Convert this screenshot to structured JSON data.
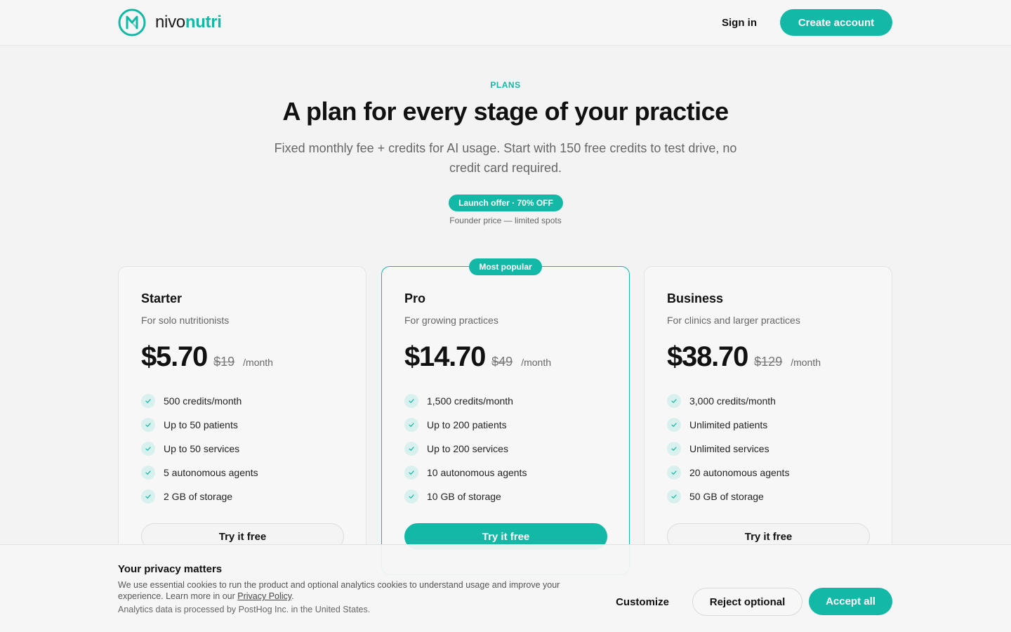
{
  "header": {
    "logo_part1": "nivo",
    "logo_part2": "nutri",
    "signin_label": "Sign in",
    "create_label": "Create account"
  },
  "hero": {
    "eyebrow": "PLANS",
    "title": "A plan for every stage of your practice",
    "subtitle": "Fixed monthly fee + credits for AI usage. Start with 150 free credits to test drive, no credit card required.",
    "offer_badge": "Launch offer · 70% OFF",
    "founder_note": "Founder price — limited spots"
  },
  "plans": [
    {
      "name": "Starter",
      "desc": "For solo nutritionists",
      "price": "$5.70",
      "old_price": "$19",
      "period": "/month",
      "features": [
        "500 credits/month",
        "Up to 50 patients",
        "Up to 50 services",
        "5 autonomous agents",
        "2 GB of storage"
      ],
      "cta": "Try it free"
    },
    {
      "name": "Pro",
      "badge": "Most popular",
      "desc": "For growing practices",
      "price": "$14.70",
      "old_price": "$49",
      "period": "/month",
      "features": [
        "1,500 credits/month",
        "Up to 200 patients",
        "Up to 200 services",
        "10 autonomous agents",
        "10 GB of storage"
      ],
      "cta": "Try it free"
    },
    {
      "name": "Business",
      "desc": "For clinics and larger practices",
      "price": "$38.70",
      "old_price": "$129",
      "period": "/month",
      "features": [
        "3,000 credits/month",
        "Unlimited patients",
        "Unlimited services",
        "20 autonomous agents",
        "50 GB of storage"
      ],
      "cta": "Try it free"
    }
  ],
  "cookie": {
    "title": "Your privacy matters",
    "text": "We use essential cookies to run the product and optional analytics cookies to understand usage and improve your experience. Learn more in our",
    "link": "Privacy Policy",
    "text_end": ".",
    "analytics_note": "Analytics data is processed by PostHog Inc. in the United States.",
    "customize_label": "Customize",
    "reject_label": "Reject optional",
    "accept_label": "Accept all"
  },
  "colors": {
    "accent": "#14b8a6",
    "check_bg": "#d9f1ee"
  },
  "icons": {
    "logo": "nivonutri-logo-icon",
    "check": "check-icon"
  }
}
